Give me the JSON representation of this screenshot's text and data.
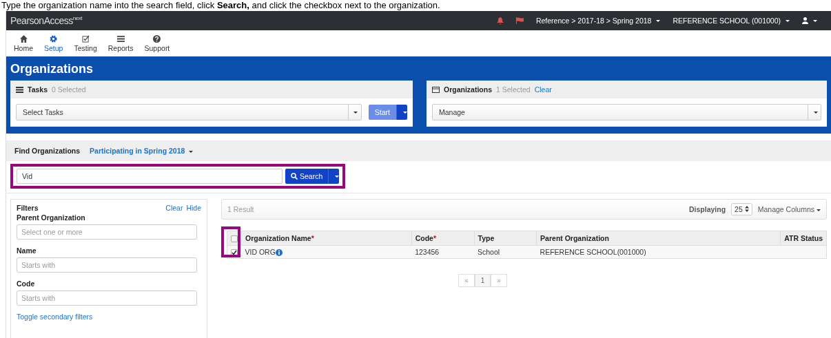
{
  "instruction": "Type the organization name into the search field, click **Search,** and click the checkbox next to the organization.",
  "navbar": {
    "brand": "PearsonAccess",
    "brand_sup": "next",
    "context": "Reference > 2017-18 > Spring 2018",
    "organization": "REFERENCE SCHOOL (001000)"
  },
  "nav_items": [
    {
      "label": "Home",
      "selected": false
    },
    {
      "label": "Setup",
      "selected": true
    },
    {
      "label": "Testing",
      "selected": false
    },
    {
      "label": "Reports",
      "selected": false
    },
    {
      "label": "Support",
      "selected": false
    }
  ],
  "page_title": "Organizations",
  "tasks_panel": {
    "title": "Tasks",
    "count": "0 Selected",
    "select": "Select Tasks",
    "button": "Start"
  },
  "orgs_panel": {
    "title": "Organizations",
    "count": "1 Selected",
    "clear": "Clear",
    "select": "Manage"
  },
  "find": {
    "title": "Find Organizations",
    "scope": "Participating in Spring 2018",
    "value": "Vid",
    "button": "Search",
    "highlighted": true
  },
  "filters": {
    "title": "Filters",
    "clear": "Clear",
    "hide": "Hide",
    "fields": [
      {
        "label": "Parent Organization",
        "placeholder": "Select one or more"
      },
      {
        "label": "Name",
        "placeholder": "Starts with"
      },
      {
        "label": "Code",
        "placeholder": "Starts with"
      }
    ],
    "toggle": "Toggle secondary filters"
  },
  "results": {
    "count": "1 Result",
    "displaying_label": "Displaying",
    "page_size": "25",
    "manage_columns": "Manage Columns"
  },
  "table": {
    "checkbox_column_highlighted": true,
    "header_checked": false,
    "columns": [
      {
        "label": "Organization Name",
        "required_mark": "*"
      },
      {
        "label": "Code",
        "required_mark": "*"
      },
      {
        "label": "Type"
      },
      {
        "label": "Parent Organization"
      },
      {
        "label": "ATR Status"
      }
    ],
    "rows": [
      {
        "checked": true,
        "info": true,
        "cells": [
          "VID ORG",
          "123456",
          "School",
          "REFERENCE SCHOOL(001000)",
          null
        ]
      }
    ]
  },
  "pagination": {
    "prev": "«",
    "page": "1",
    "next": "»"
  }
}
